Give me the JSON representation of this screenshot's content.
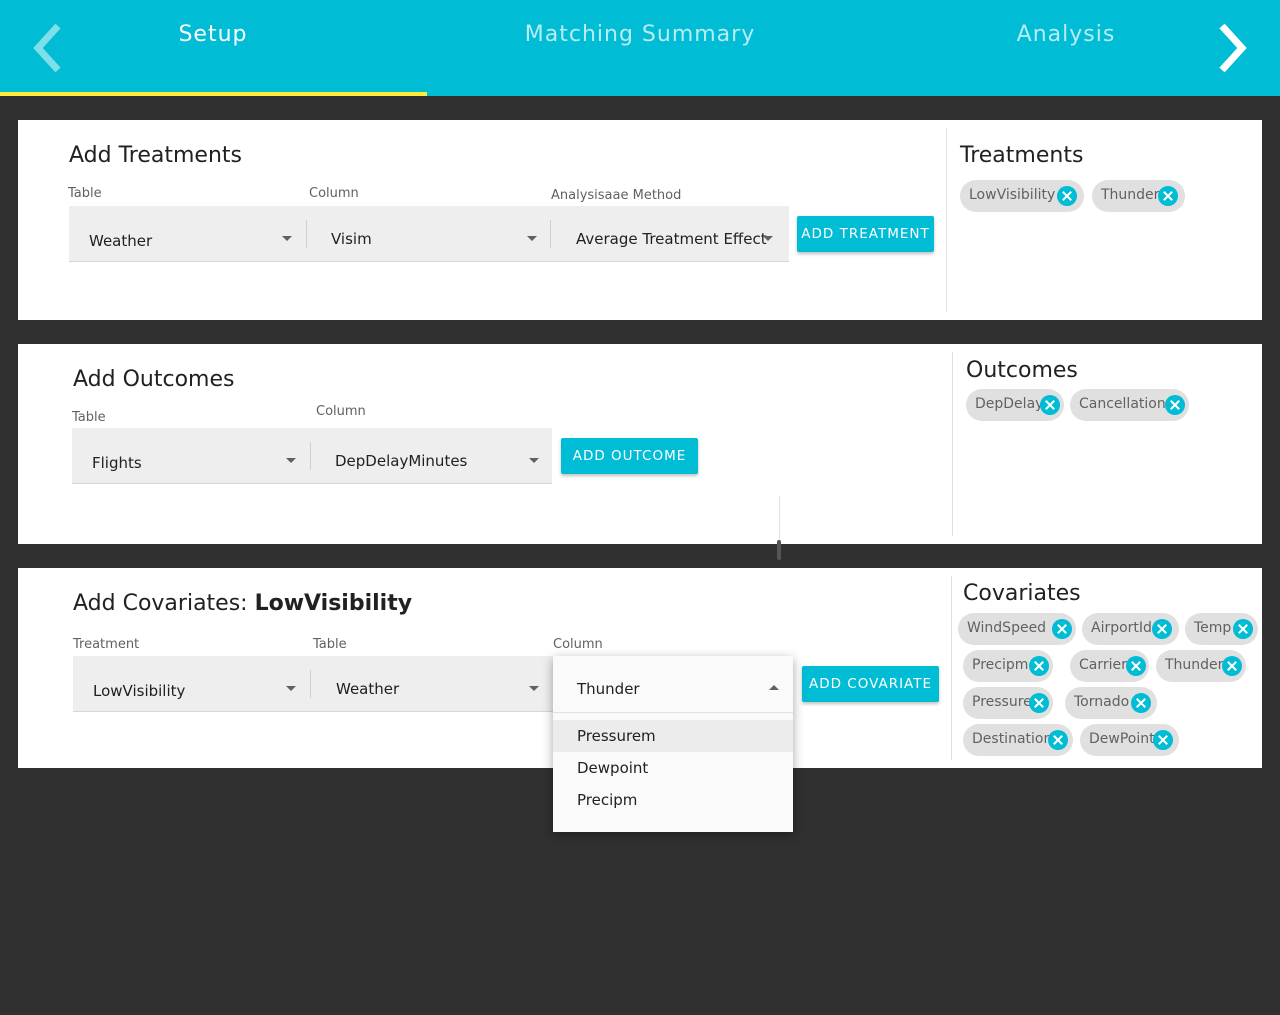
{
  "header": {
    "tabs": [
      {
        "label": "Setup",
        "active": true
      },
      {
        "label": "Matching Summary",
        "active": false
      },
      {
        "label": "Analysis",
        "active": false
      }
    ],
    "indicator_color": "#ffeb3b",
    "accent_color": "#00bcd4",
    "prev_icon": "chevron-left-icon",
    "next_icon": "chevron-right-icon"
  },
  "treatments_card": {
    "title": "Add Treatments",
    "table_label": "Table",
    "table_value": "Weather",
    "column_label": "Column",
    "column_value": "Visim",
    "method_label": "Analysisaae Method",
    "method_value": "Average Treatment Effect",
    "button": "ADD TREATMENT",
    "side_title": "Treatments",
    "chips": [
      "LowVisibility",
      "Thunder"
    ]
  },
  "outcomes_card": {
    "title": "Add Outcomes",
    "table_label": "Table",
    "table_value": "Flights",
    "column_label": "Column",
    "column_value": "DepDelayMinutes",
    "button": "ADD OUTCOME",
    "side_title": "Outcomes",
    "chips": [
      "DepDelay",
      "Cancellation"
    ]
  },
  "covariates_card": {
    "title_prefix": "Add Covariates: ",
    "title_treatment": "LowVisibility",
    "treatment_label": "Treatment",
    "treatment_value": "LowVisibility",
    "table_label": "Table",
    "table_value": "Weather",
    "column_label": "Column",
    "column_value": "Thunder",
    "button": "ADD COVARIATE",
    "side_title": "Covariates",
    "chips": [
      "WindSpeed",
      "AirportId",
      "Temp",
      "Precipm",
      "Carrier",
      "Thunder",
      "Pressure",
      "Tornado",
      "Destination",
      "DewPoint"
    ]
  },
  "column_dropdown": {
    "options": [
      "Pressurem",
      "Dewpoint",
      "Precipm"
    ],
    "highlighted": "Pressurem"
  }
}
